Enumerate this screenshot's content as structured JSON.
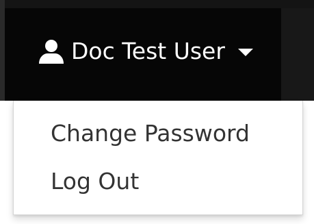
{
  "navbar": {
    "user_menu": {
      "label": "Doc Test User",
      "icon": "user-icon",
      "caret_icon": "caret-down-icon",
      "text_color": "#ffffff",
      "background": "#060606"
    }
  },
  "dropdown": {
    "items": [
      {
        "label": "Change Password"
      },
      {
        "label": "Log Out"
      }
    ],
    "text_color": "#333333"
  }
}
